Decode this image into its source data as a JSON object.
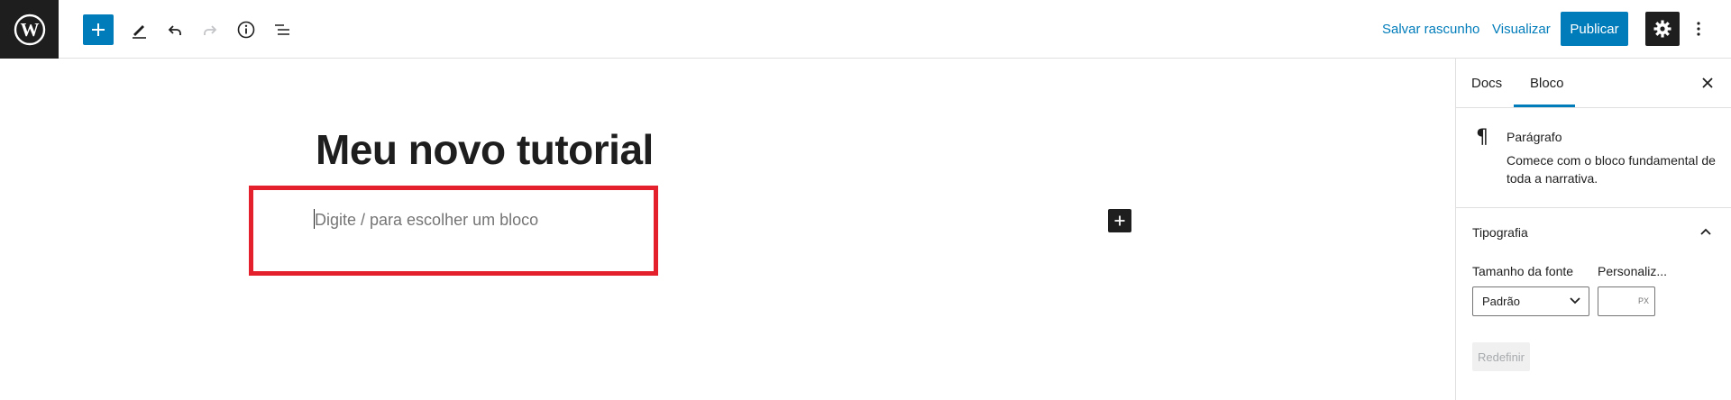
{
  "toolbar": {
    "save_draft": "Salvar rascunho",
    "preview": "Visualizar",
    "publish": "Publicar"
  },
  "editor": {
    "post_title": "Meu novo tutorial",
    "paragraph_placeholder": "Digite / para escolher um bloco",
    "highlight_color": "#e3202b"
  },
  "sidebar": {
    "tabs": [
      "Docs",
      "Bloco"
    ],
    "active_tab": "Bloco",
    "block": {
      "icon": "paragraph-icon",
      "name": "Parágrafo",
      "description": "Comece com o bloco fundamental de toda a narrativa."
    },
    "typography": {
      "title": "Tipografia",
      "font_size_label": "Tamanho da fonte",
      "custom_label": "Personaliz...",
      "font_size_value": "Padrão",
      "custom_unit": "PX",
      "reset": "Redefinir"
    }
  },
  "colors": {
    "accent": "#007cba",
    "dark": "#1e1e1e"
  }
}
